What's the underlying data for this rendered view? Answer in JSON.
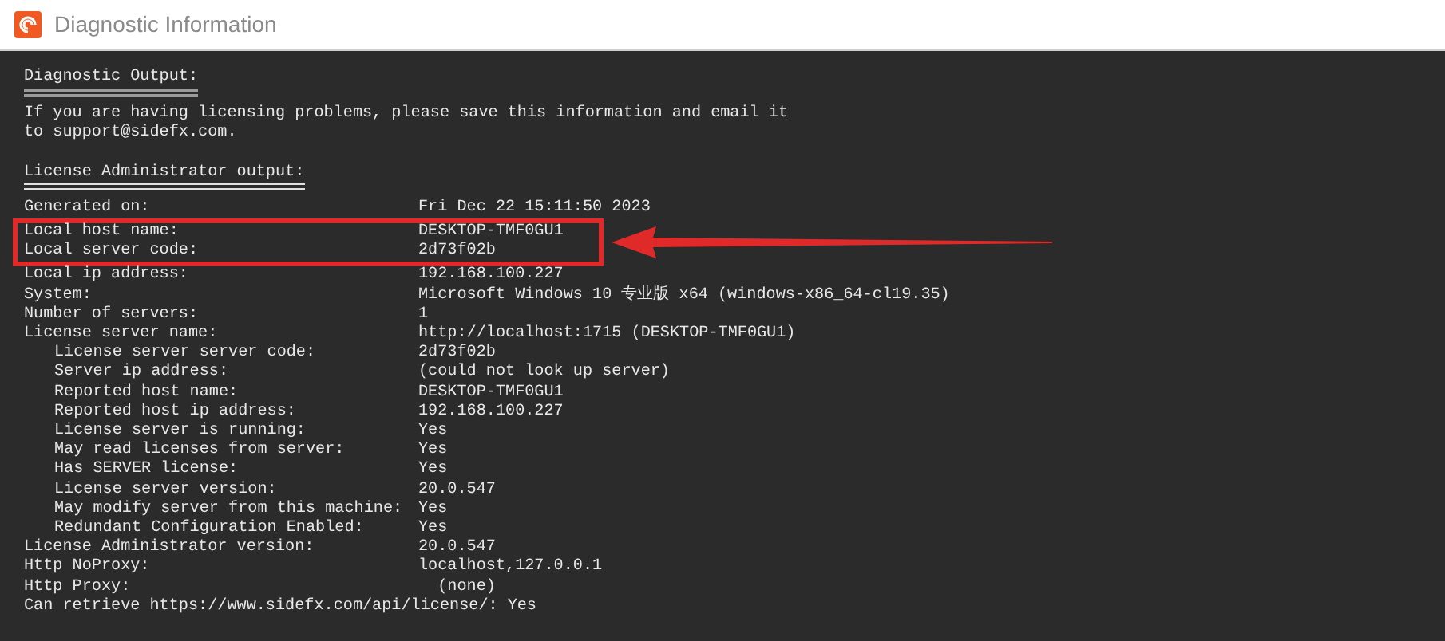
{
  "window": {
    "title": "Diagnostic Information"
  },
  "heading": "Diagnostic Output:",
  "intro": [
    "If you are having licensing problems, please save this information and email it",
    "to support@sidefx.com."
  ],
  "section": "License Administrator output:",
  "rows": [
    {
      "label": "Generated on:",
      "value": "Fri Dec 22 15:11:50 2023",
      "highlighted": false
    },
    {
      "label": "Local host name:",
      "value": "DESKTOP-TMF0GU1",
      "highlighted": true
    },
    {
      "label": "Local server code:",
      "value": "2d73f02b",
      "highlighted": true
    },
    {
      "label": "Local ip address:",
      "value": "192.168.100.227",
      "highlighted": false
    },
    {
      "label": "System:",
      "value": "Microsoft Windows 10 专业版 x64 (windows-x86_64-cl19.35)",
      "highlighted": false
    },
    {
      "label": "Number of servers:",
      "value": "1",
      "highlighted": false
    },
    {
      "label": "License server name:",
      "value": "http://localhost:1715 (DESKTOP-TMF0GU1)",
      "highlighted": false,
      "children": [
        {
          "label": "License server server code:",
          "value": "2d73f02b"
        },
        {
          "label": "Server ip address:",
          "value": "(could not look up server)"
        },
        {
          "label": "Reported host name:",
          "value": "DESKTOP-TMF0GU1"
        },
        {
          "label": "Reported host ip address:",
          "value": "192.168.100.227"
        },
        {
          "label": "License server is running:",
          "value": "Yes"
        },
        {
          "label": "May read licenses from server:",
          "value": "Yes"
        },
        {
          "label": "Has SERVER license:",
          "value": "Yes"
        },
        {
          "label": "License server version:",
          "value": "20.0.547"
        },
        {
          "label": "May modify server from this machine:",
          "value": "Yes"
        },
        {
          "label": "Redundant Configuration Enabled:",
          "value": "Yes"
        }
      ]
    },
    {
      "label": "License Administrator version:",
      "value": "20.0.547",
      "highlighted": false
    },
    {
      "label": "Http NoProxy:",
      "value": "localhost,127.0.0.1",
      "highlighted": false
    },
    {
      "label": "Http Proxy:",
      "value": "  (none)",
      "highlighted": false
    },
    {
      "label": "Can retrieve https://www.sidefx.com/api/license/:",
      "value": "Yes",
      "highlighted": false
    }
  ]
}
